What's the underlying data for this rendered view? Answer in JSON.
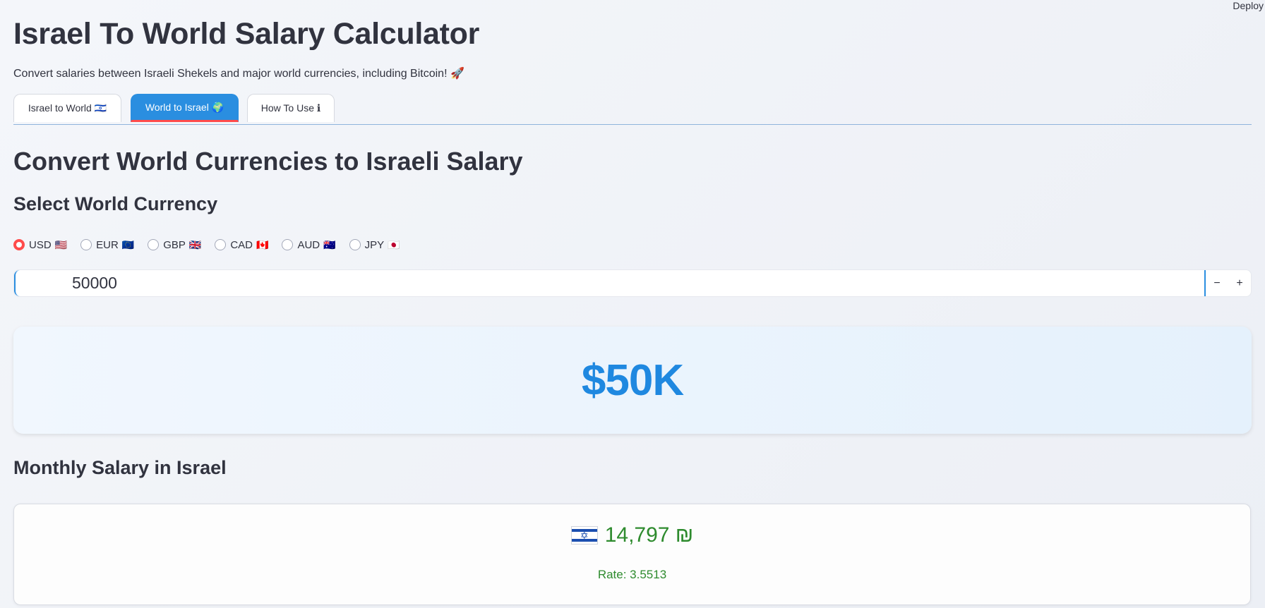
{
  "header": {
    "deploy_label": "Deploy"
  },
  "page": {
    "title": "Israel To World Salary Calculator",
    "subtitle": "Convert salaries between Israeli Shekels and major world currencies, including Bitcoin! 🚀"
  },
  "tabs": [
    {
      "label": "Israel to World 🇮🇱",
      "active": false
    },
    {
      "label": "World to Israel 🌍",
      "active": true
    },
    {
      "label": "How To Use ℹ",
      "active": false
    }
  ],
  "section": {
    "heading": "Convert World Currencies to Israeli Salary",
    "currency_heading": "Select World Currency",
    "currencies": [
      {
        "code": "USD",
        "flag": "🇺🇸",
        "selected": true
      },
      {
        "code": "EUR",
        "flag": "🇪🇺",
        "selected": false
      },
      {
        "code": "GBP",
        "flag": "🇬🇧",
        "selected": false
      },
      {
        "code": "CAD",
        "flag": "🇨🇦",
        "selected": false
      },
      {
        "code": "AUD",
        "flag": "🇦🇺",
        "selected": false
      },
      {
        "code": "JPY",
        "flag": "🇯🇵",
        "selected": false
      }
    ],
    "salary_input": {
      "value": "50000",
      "decrement_label": "−",
      "increment_label": "+"
    },
    "display_amount": "$50K"
  },
  "result": {
    "heading": "Monthly Salary in Israel",
    "flag": "🇮🇱",
    "amount": "14,797 ₪",
    "rate": "Rate: 3.5513"
  },
  "colors": {
    "accent_blue": "#2a8ee0",
    "accent_red": "#ff4b4b",
    "result_green": "#2e8b2e",
    "big_amount_blue": "#1f88e0"
  }
}
